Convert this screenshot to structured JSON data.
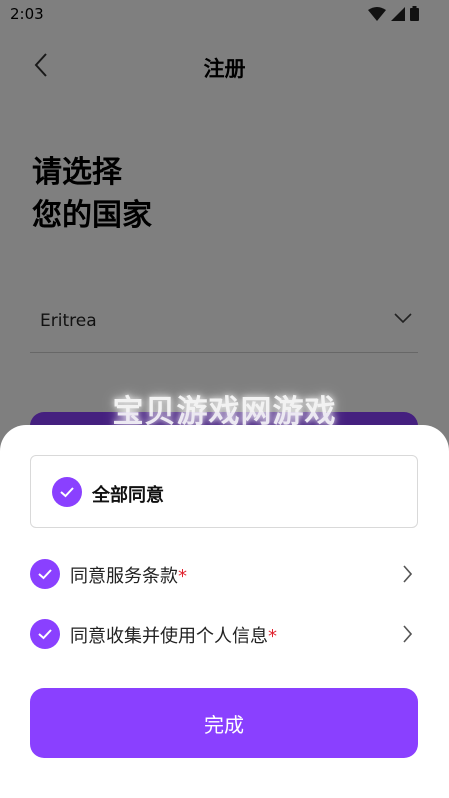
{
  "status_bar": {
    "time": "2:03"
  },
  "header": {
    "title": "注册"
  },
  "heading": {
    "line1": "请选择",
    "line2": "您的国家"
  },
  "country": {
    "value": "Eritrea"
  },
  "watermark": {
    "text": "宝贝游戏网游戏"
  },
  "sheet": {
    "agree_all_label": "全部同意",
    "items": [
      {
        "label": "同意服务条款",
        "required": "*"
      },
      {
        "label": "同意收集并使用个人信息",
        "required": "*"
      }
    ],
    "done_label": "完成"
  },
  "colors": {
    "accent": "#8a40ff",
    "required": "#e0242f"
  }
}
